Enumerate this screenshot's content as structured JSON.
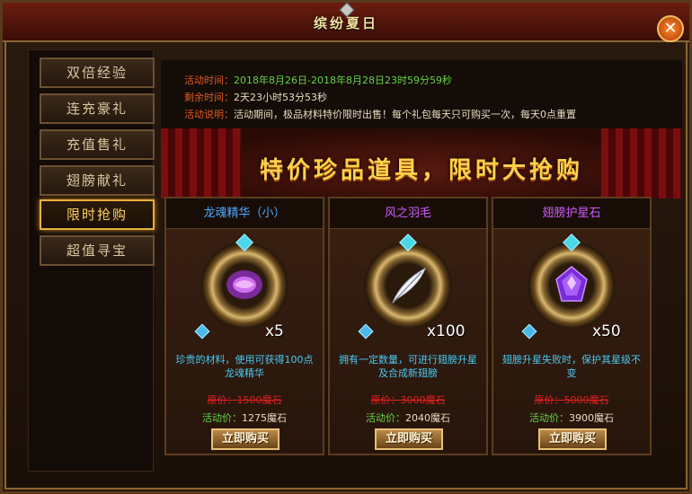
{
  "window": {
    "title": "缤纷夏日",
    "close_label": "✕"
  },
  "sidebar": {
    "items": [
      {
        "label": "双倍经验",
        "active": false
      },
      {
        "label": "连充豪礼",
        "active": false
      },
      {
        "label": "充值售礼",
        "active": false
      },
      {
        "label": "翅膀献礼",
        "active": false
      },
      {
        "label": "限时抢购",
        "active": true
      },
      {
        "label": "超值寻宝",
        "active": false
      }
    ]
  },
  "info": {
    "time_label": "活动时间：",
    "time_value": "2018年8月26日-2018年8月28日23时59分59秒",
    "remain_label": "剩余时间：",
    "remain_value": "2天23小时53分53秒",
    "desc_label": "活动说明：",
    "desc_value": "活动期间，极品材料特价限时出售！每个礼包每天只可购买一次，每天0点重置"
  },
  "banner": {
    "text": "特价珍品道具，限时大抢购"
  },
  "items": [
    {
      "name": "龙魂精华（小）",
      "name_color": "#4aa8ff",
      "icon": "dragon-soul-crystal-icon",
      "quantity": "x5",
      "description": "珍贵的材料，使用可获得100点龙魂精华",
      "original_price": "原价：1500魔石",
      "sale_label": "活动价：",
      "sale_value": "1275魔石",
      "buy_label": "立即购买"
    },
    {
      "name": "风之羽毛",
      "name_color": "#d05aff",
      "icon": "wind-feather-icon",
      "quantity": "x100",
      "description": "拥有一定数量，可进行翅膀升星及合成新翅膀",
      "original_price": "原价：3000魔石",
      "sale_label": "活动价：",
      "sale_value": "2040魔石",
      "buy_label": "立即购买"
    },
    {
      "name": "翅膀护星石",
      "name_color": "#d05aff",
      "icon": "wing-protect-star-stone-icon",
      "quantity": "x50",
      "description": "翅膀升星失败时，保护其星级不变",
      "original_price": "原价：5000魔石",
      "sale_label": "活动价：",
      "sale_value": "3900魔石",
      "buy_label": "立即购买"
    }
  ],
  "colors": {
    "accent_gold": "#ffd24a",
    "label_orange": "#e05a20",
    "green_value": "#66d24a",
    "strike_red": "#e02020",
    "desc_blue": "#4ac8f0"
  }
}
